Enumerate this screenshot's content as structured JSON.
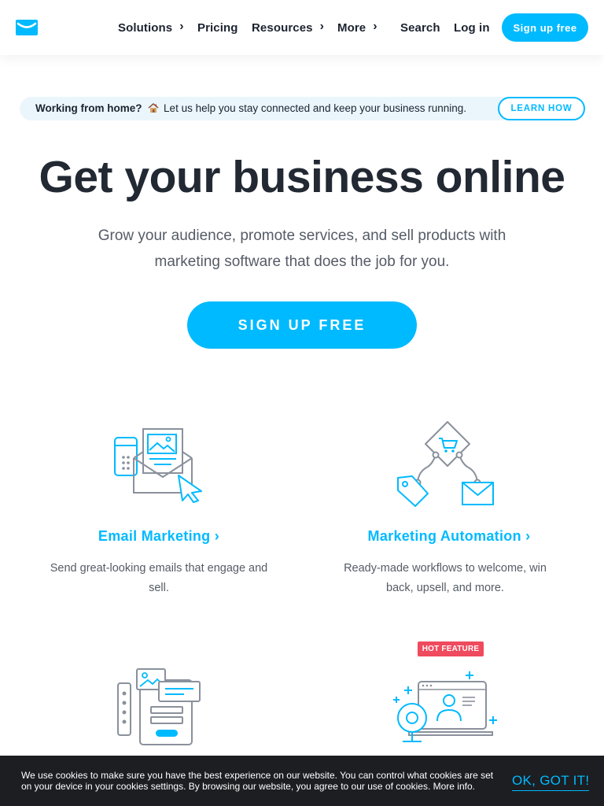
{
  "header": {
    "logo_icon": "envelope-logo-icon",
    "nav": [
      {
        "label": "Solutions",
        "has_chevron": true
      },
      {
        "label": "Pricing",
        "has_chevron": false
      },
      {
        "label": "Resources",
        "has_chevron": true
      },
      {
        "label": "More",
        "has_chevron": true
      },
      {
        "label": "Search",
        "has_chevron": false
      },
      {
        "label": "Log in",
        "has_chevron": false
      }
    ],
    "chevron": "›",
    "signup_label": "Sign up free"
  },
  "banner": {
    "bold_text": "Working from home?",
    "icon": "house-icon",
    "text": "Let us help you stay connected and keep your business running.",
    "button_label": "LEARN HOW"
  },
  "hero": {
    "title": "Get your business online",
    "subtitle": "Grow your audience, promote services, and sell products with marketing software that does the job for you.",
    "cta_label": "SIGN UP FREE"
  },
  "features": [
    {
      "icon": "email-marketing-icon",
      "title": "Email Marketing ›",
      "description": "Send great-looking emails that engage and sell."
    },
    {
      "icon": "marketing-automation-icon",
      "title": "Marketing Automation ›",
      "description": "Ready-made workflows to welcome, win back, upsell, and more."
    },
    {
      "icon": "landing-pages-icon"
    },
    {
      "icon": "webinars-icon",
      "badge": "HOT FEATURE"
    }
  ],
  "cookie": {
    "text": "We use cookies to make sure you have the best experience on our website. You can control what cookies are set on your device in your cookies settings. By browsing our website, you agree to our use of cookies. More info.",
    "button_label": "OK, GOT IT!"
  },
  "colors": {
    "accent": "#00baff",
    "heading": "#222933",
    "body_text": "#555b66",
    "banner_bg": "#ebf6fc",
    "hot_badge": "#ef4a5e",
    "cookie_bg": "#1c1e22",
    "icon_gray": "#8a919c"
  }
}
